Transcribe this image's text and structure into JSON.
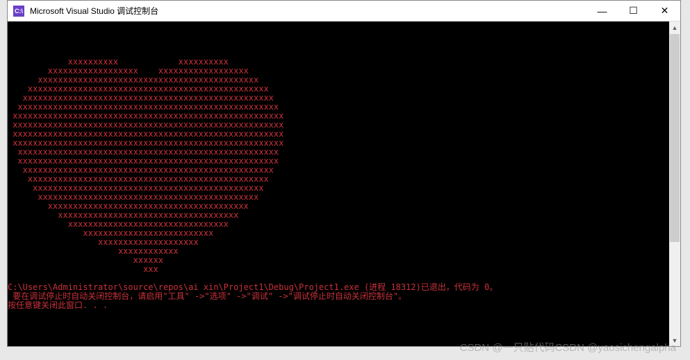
{
  "titlebar": {
    "icon_text": "C:\\",
    "title": "Microsoft Visual Studio 调试控制台",
    "minimize": "—",
    "maximize": "☐",
    "close": "✕"
  },
  "console": {
    "heart_lines": [
      "",
      "",
      "",
      "",
      "            xxxxxxxxxx            xxxxxxxxxx",
      "        xxxxxxxxxxxxxxxxxx    xxxxxxxxxxxxxxxxxx",
      "      xxxxxxxxxxxxxxxxxxxxxxxxxxxxxxxxxxxxxxxxxxxx",
      "    xxxxxxxxxxxxxxxxxxxxxxxxxxxxxxxxxxxxxxxxxxxxxxxx",
      "   xxxxxxxxxxxxxxxxxxxxxxxxxxxxxxxxxxxxxxxxxxxxxxxxxx",
      "  xxxxxxxxxxxxxxxxxxxxxxxxxxxxxxxxxxxxxxxxxxxxxxxxxxxx",
      " xxxxxxxxxxxxxxxxxxxxxxxxxxxxxxxxxxxxxxxxxxxxxxxxxxxxxx",
      " xxxxxxxxxxxxxxxxxxxxxxxxxxxxxxxxxxxxxxxxxxxxxxxxxxxxxx",
      " xxxxxxxxxxxxxxxxxxxxxxxxxxxxxxxxxxxxxxxxxxxxxxxxxxxxxx",
      " xxxxxxxxxxxxxxxxxxxxxxxxxxxxxxxxxxxxxxxxxxxxxxxxxxxxxx",
      "  xxxxxxxxxxxxxxxxxxxxxxxxxxxxxxxxxxxxxxxxxxxxxxxxxxxx",
      "  xxxxxxxxxxxxxxxxxxxxxxxxxxxxxxxxxxxxxxxxxxxxxxxxxxxx",
      "   xxxxxxxxxxxxxxxxxxxxxxxxxxxxxxxxxxxxxxxxxxxxxxxxxx",
      "    xxxxxxxxxxxxxxxxxxxxxxxxxxxxxxxxxxxxxxxxxxxxxxxx",
      "     xxxxxxxxxxxxxxxxxxxxxxxxxxxxxxxxxxxxxxxxxxxxxx",
      "      xxxxxxxxxxxxxxxxxxxxxxxxxxxxxxxxxxxxxxxxxxxx",
      "        xxxxxxxxxxxxxxxxxxxxxxxxxxxxxxxxxxxxxxxx",
      "          xxxxxxxxxxxxxxxxxxxxxxxxxxxxxxxxxxxx",
      "            xxxxxxxxxxxxxxxxxxxxxxxxxxxxxxxx",
      "               xxxxxxxxxxxxxxxxxxxxxxxxxx",
      "                  xxxxxxxxxxxxxxxxxxxx",
      "                      xxxxxxxxxxxx",
      "                         xxxxxx",
      "                           xxx",
      ""
    ],
    "exit_line": "C:\\Users\\Administrator\\source\\repos\\ai xin\\Project1\\Debug\\Project1.exe (进程 18312)已退出，代码为 0。",
    "hint_line": " 要在调试停止时自动关闭控制台，请启用\"工具\" ->\"选项\" ->\"调试\" ->\"调试停止时自动关闭控制台\"。",
    "anykey_line": "按任意键关闭此窗口. . ."
  },
  "watermark": "CSDN @一只贴代码CSDN @yaosichengalpha"
}
